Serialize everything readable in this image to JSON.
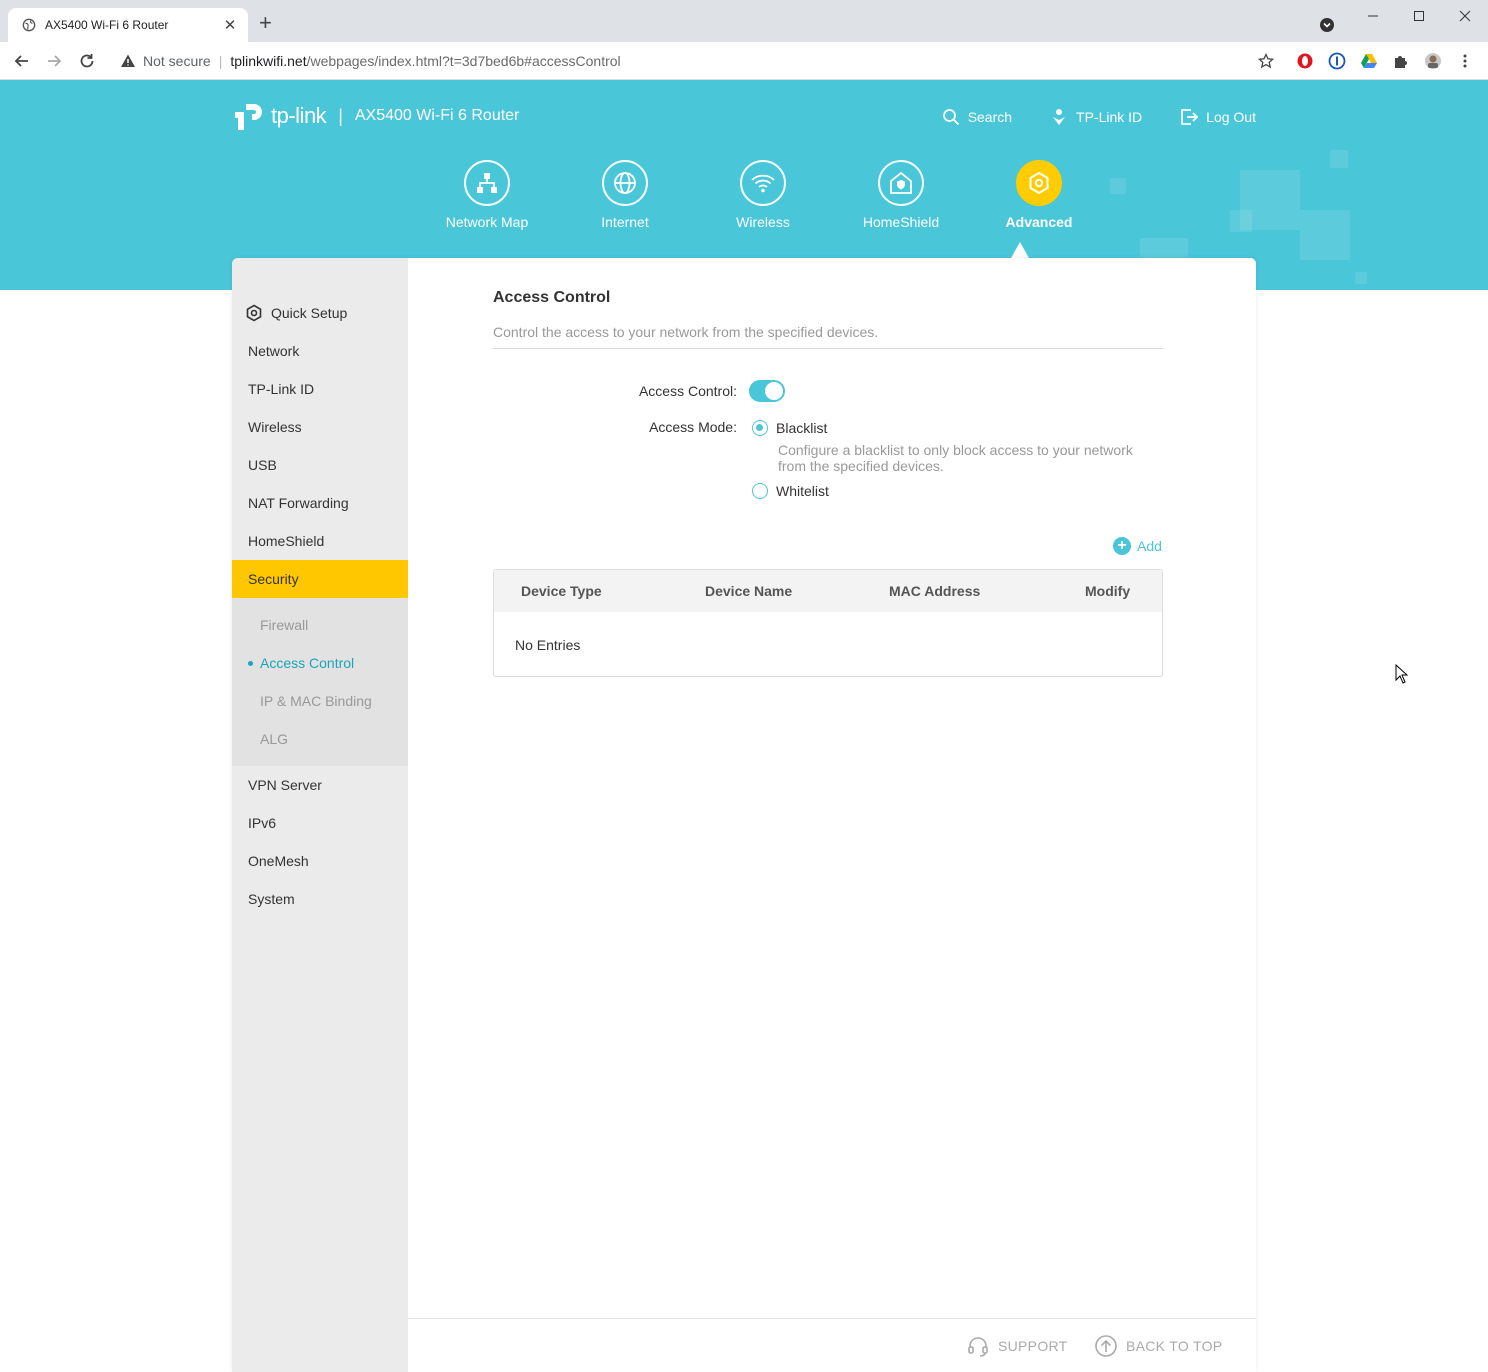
{
  "browser": {
    "tab_title": "AX5400 Wi-Fi 6 Router",
    "tab_close": "✕",
    "new_tab": "+",
    "not_secure": "Not secure",
    "url_host": "tplinkwifi.net",
    "url_path": "/webpages/index.html?t=3d7bed6b#accessControl"
  },
  "header": {
    "brand": "tp-link",
    "divider": "|",
    "model": "AX5400 Wi-Fi 6 Router",
    "links": {
      "search": "Search",
      "tplink_id": "TP-Link ID",
      "logout": "Log Out"
    },
    "nav": {
      "network_map": "Network Map",
      "internet": "Internet",
      "wireless": "Wireless",
      "homeshield": "HomeShield",
      "advanced": "Advanced"
    },
    "active_nav": "Advanced"
  },
  "sidebar": {
    "items": {
      "quick_setup": "Quick Setup",
      "network": "Network",
      "tplink_id": "TP-Link ID",
      "wireless": "Wireless",
      "usb": "USB",
      "nat_forwarding": "NAT Forwarding",
      "homeshield": "HomeShield",
      "security": "Security",
      "vpn_server": "VPN Server",
      "ipv6": "IPv6",
      "onemesh": "OneMesh",
      "system": "System"
    },
    "security_sub": {
      "firewall": "Firewall",
      "access_control": "Access Control",
      "ip_mac_binding": "IP & MAC Binding",
      "alg": "ALG"
    }
  },
  "content": {
    "title": "Access Control",
    "description": "Control the access to your network from the specified devices.",
    "access_control_label": "Access Control:",
    "access_control_enabled": true,
    "access_mode_label": "Access Mode:",
    "mode_blacklist": "Blacklist",
    "mode_blacklist_hint": "Configure a blacklist to only block access to your network from the specified devices.",
    "mode_whitelist": "Whitelist",
    "selected_mode": "Blacklist",
    "add_label": "Add",
    "table": {
      "headers": {
        "device_type": "Device Type",
        "device_name": "Device Name",
        "mac_address": "MAC Address",
        "modify": "Modify"
      },
      "empty_text": "No Entries"
    }
  },
  "footer": {
    "support": "SUPPORT",
    "back_to_top": "BACK TO TOP"
  },
  "colors": {
    "accent": "#4ac6d9",
    "active_highlight": "#ffc700",
    "sidebar_bg": "#ebebeb"
  }
}
